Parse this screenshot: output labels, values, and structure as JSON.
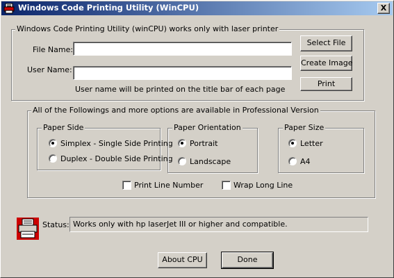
{
  "window": {
    "title": "Windows Code Printing Utility (WinCPU)",
    "close_label": "X"
  },
  "main_group": {
    "title": "Windows Code Printing Utility (winCPU) works only with laser printer",
    "file_name_label": "File Name:",
    "file_name_value": "",
    "user_name_label": "User Name:",
    "user_name_value": "",
    "user_name_hint": "User name will be printed on the title bar of each page",
    "select_file_label": "Select File",
    "create_image_label": "Create Image",
    "print_label": "Print"
  },
  "pro_group": {
    "title": "All of the Followings and more  options are available in Professional Version",
    "paper_side": {
      "title": "Paper Side",
      "options": [
        "Simplex - Single Side Printing",
        "Duplex - Double Side Printing"
      ],
      "selected": "Simplex - Single Side Printing"
    },
    "paper_orientation": {
      "title": "Paper Orientation",
      "options": [
        "Portrait",
        "Landscape"
      ],
      "selected": "Portrait"
    },
    "paper_size": {
      "title": "Paper Size",
      "options": [
        "Letter",
        "A4"
      ],
      "selected": "Letter"
    },
    "print_line_number_label": "Print Line Number",
    "print_line_number_checked": false,
    "wrap_long_line_label": "Wrap Long Line",
    "wrap_long_line_checked": false
  },
  "status": {
    "label": "Status:",
    "text": "Works only with hp laserJet III or higher and compatible.",
    "icon": "printer-icon"
  },
  "footer": {
    "about_label": "About CPU",
    "done_label": "Done"
  },
  "colors": {
    "titlebar_start": "#0a246a",
    "titlebar_end": "#a6caf0",
    "face": "#d4d0c8"
  }
}
